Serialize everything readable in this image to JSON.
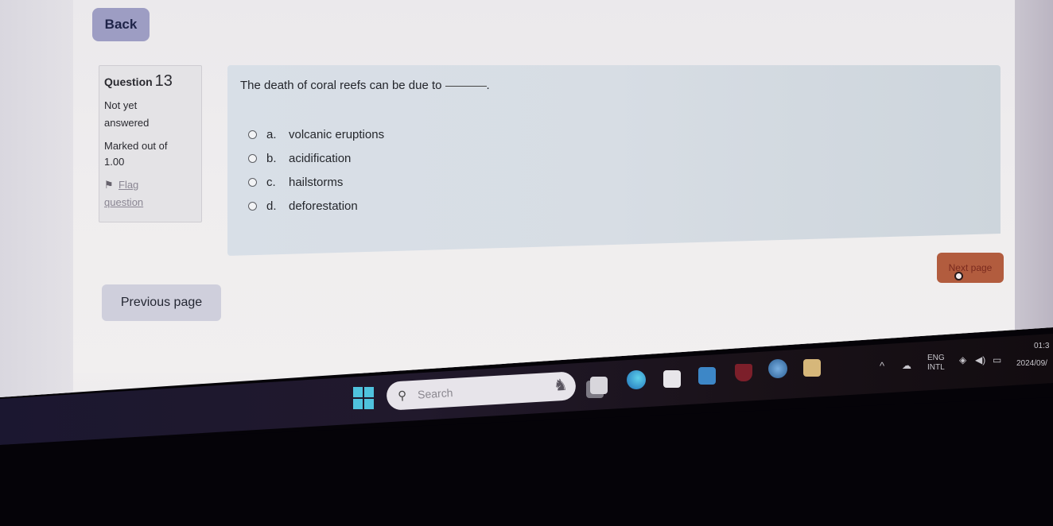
{
  "navigation": {
    "back_label": "Back"
  },
  "question_info": {
    "label": "Question",
    "number": "13",
    "state_line1": "Not yet",
    "state_line2": "answered",
    "grade_line1": "Marked out of",
    "grade_line2": "1.00",
    "flag_line1": "Flag",
    "flag_line2": "question"
  },
  "question": {
    "text": "The death of coral reefs can be due to",
    "suffix": ".",
    "answers": [
      {
        "letter": "a.",
        "text": "volcanic eruptions",
        "selected": false
      },
      {
        "letter": "b.",
        "text": "acidification",
        "selected": false
      },
      {
        "letter": "c.",
        "text": "hailstorms",
        "selected": false
      },
      {
        "letter": "d.",
        "text": "deforestation",
        "selected": false
      }
    ]
  },
  "buttons": {
    "next_label": "Next page",
    "previous_label": "Previous page"
  },
  "colors": {
    "back_button": "#9d9dc3",
    "next_button": "#b25c3e",
    "previous_button": "#cfcfdc",
    "formulation_bg": "#d8dfe7"
  },
  "taskbar": {
    "search_placeholder": "Search",
    "apps": [
      "start-icon",
      "task-view-icon",
      "edge-icon",
      "store-icon",
      "app-arrow-icon",
      "mcafee-icon",
      "help-icon",
      "file-explorer-icon"
    ],
    "tray": {
      "lang_line1": "ENG",
      "lang_line2": "INTL",
      "time": "01:3",
      "date": "2024/09/"
    }
  }
}
